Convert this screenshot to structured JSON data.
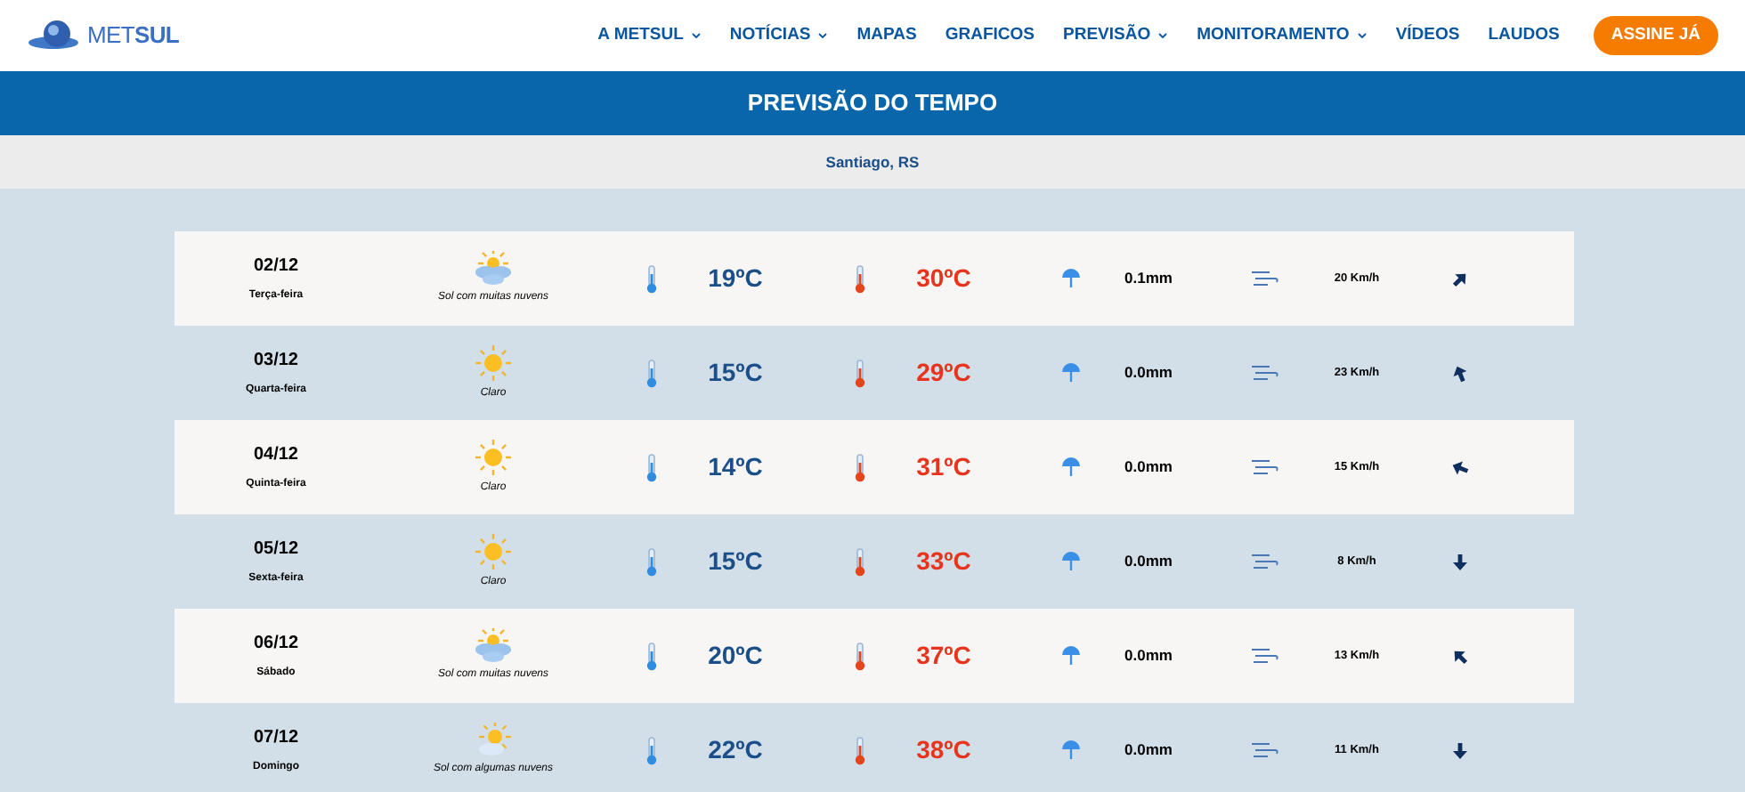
{
  "logo": {
    "text": "MET**SUL**"
  },
  "nav": [
    {
      "label": "A METSUL",
      "dropdown": true
    },
    {
      "label": "NOTÍCIAS",
      "dropdown": true
    },
    {
      "label": "MAPAS",
      "dropdown": false
    },
    {
      "label": "GRAFICOS",
      "dropdown": false
    },
    {
      "label": "PREVISÃO",
      "dropdown": true
    },
    {
      "label": "MONITORAMENTO",
      "dropdown": true
    },
    {
      "label": "VÍDEOS",
      "dropdown": false
    },
    {
      "label": "LAUDOS",
      "dropdown": false
    }
  ],
  "cta": "ASSINE JÁ",
  "banner": "PREVISÃO DO TEMPO",
  "city": "Santiago, RS",
  "days": [
    {
      "date": "02/12",
      "weekday": "Terça-feira",
      "kind": "sun-clouds",
      "condition": "Sol com muitas nuvens",
      "min": "19ºC",
      "max": "30ºC",
      "rain": "0.1mm",
      "wind": "20 Km/h",
      "arrow": {
        "kind": "ne"
      }
    },
    {
      "date": "03/12",
      "weekday": "Quarta-feira",
      "kind": "sun",
      "condition": "Claro",
      "min": "15ºC",
      "max": "29ºC",
      "rain": "0.0mm",
      "wind": "23 Km/h",
      "arrow": {
        "kind": "nnw"
      }
    },
    {
      "date": "04/12",
      "weekday": "Quinta-feira",
      "kind": "sun",
      "condition": "Claro",
      "min": "14ºC",
      "max": "31ºC",
      "rain": "0.0mm",
      "wind": "15 Km/h",
      "arrow": {
        "kind": "wnw"
      }
    },
    {
      "date": "05/12",
      "weekday": "Sexta-feira",
      "kind": "sun",
      "condition": "Claro",
      "min": "15ºC",
      "max": "33ºC",
      "rain": "0.0mm",
      "wind": "8 Km/h",
      "arrow": {
        "kind": "s"
      }
    },
    {
      "date": "06/12",
      "weekday": "Sábado",
      "kind": "sun-clouds",
      "condition": "Sol com muitas nuvens",
      "min": "20ºC",
      "max": "37ºC",
      "rain": "0.0mm",
      "wind": "13 Km/h",
      "arrow": {
        "kind": "nw"
      }
    },
    {
      "date": "07/12",
      "weekday": "Domingo",
      "kind": "sun-few-clouds",
      "condition": "Sol com algumas nuvens",
      "min": "22ºC",
      "max": "38ºC",
      "rain": "0.0mm",
      "wind": "11 Km/h",
      "arrow": {
        "kind": "s"
      }
    }
  ]
}
